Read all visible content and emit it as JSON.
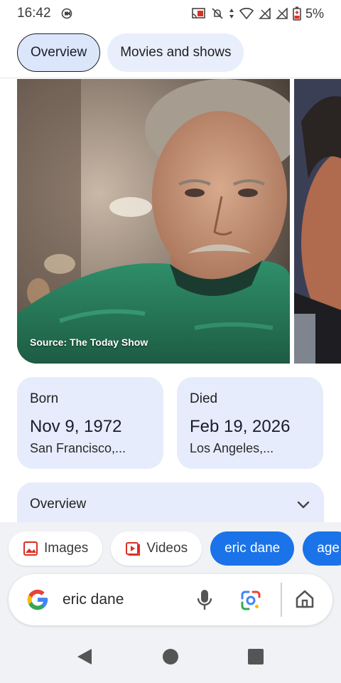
{
  "status": {
    "time": "16:42",
    "battery": "5%"
  },
  "tabs": [
    {
      "label": "Overview",
      "active": true
    },
    {
      "label": "Movies and shows",
      "active": false
    }
  ],
  "photo": {
    "source": "Source: The Today Show"
  },
  "born": {
    "label": "Born",
    "date": "Nov 9, 1972",
    "place": "San Francisco,..."
  },
  "died": {
    "label": "Died",
    "date": "Feb 19, 2026",
    "place": "Los Angeles,..."
  },
  "overview": {
    "title": "Overview"
  },
  "chips": {
    "images": "Images",
    "videos": "Videos",
    "query_chip": "eric dane",
    "partial_chip": "age"
  },
  "search": {
    "query": "eric dane"
  },
  "colors": {
    "accent": "#1a73e8",
    "card_bg": "#e6ecfb",
    "chip_red": "#d93025"
  }
}
